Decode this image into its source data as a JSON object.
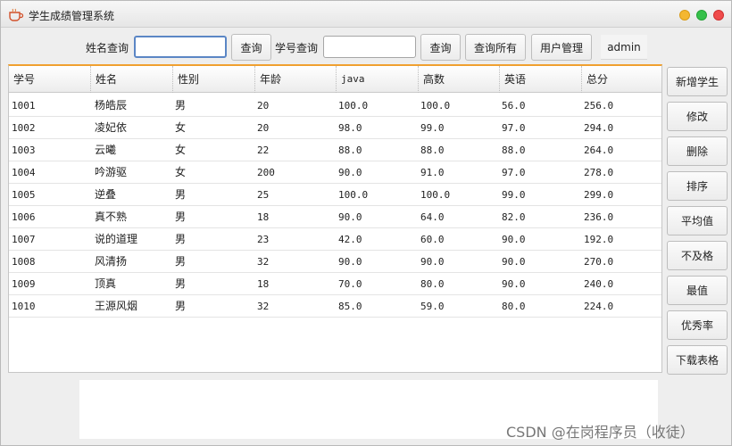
{
  "window": {
    "title": "学生成绩管理系统"
  },
  "search": {
    "name_label": "姓名查询",
    "name_value": "",
    "name_button": "查询",
    "id_label": "学号查询",
    "id_value": "",
    "id_button": "查询",
    "all_button": "查询所有",
    "user_button": "用户管理",
    "user_name": "admin"
  },
  "table": {
    "columns": [
      "学号",
      "姓名",
      "性别",
      "年龄",
      "java",
      "高数",
      "英语",
      "总分"
    ],
    "rows": [
      [
        "1001",
        "杨皓辰",
        "男",
        "20",
        "100.0",
        "100.0",
        "56.0",
        "256.0"
      ],
      [
        "1002",
        "凌妃依",
        "女",
        "20",
        "98.0",
        "99.0",
        "97.0",
        "294.0"
      ],
      [
        "1003",
        "云曦",
        "女",
        "22",
        "88.0",
        "88.0",
        "88.0",
        "264.0"
      ],
      [
        "1004",
        "吟游驱",
        "女",
        "200",
        "90.0",
        "91.0",
        "97.0",
        "278.0"
      ],
      [
        "1005",
        "逆叠",
        "男",
        "25",
        "100.0",
        "100.0",
        "99.0",
        "299.0"
      ],
      [
        "1006",
        "真不熟",
        "男",
        "18",
        "90.0",
        "64.0",
        "82.0",
        "236.0"
      ],
      [
        "1007",
        "说的道理",
        "男",
        "23",
        "42.0",
        "60.0",
        "90.0",
        "192.0"
      ],
      [
        "1008",
        "风清扬",
        "男",
        "32",
        "90.0",
        "90.0",
        "90.0",
        "270.0"
      ],
      [
        "1009",
        "顶真",
        "男",
        "18",
        "70.0",
        "80.0",
        "90.0",
        "240.0"
      ],
      [
        "1010",
        "王源风烟",
        "男",
        "32",
        "85.0",
        "59.0",
        "80.0",
        "224.0"
      ]
    ]
  },
  "actions": [
    "新增学生",
    "修改",
    "删除",
    "排序",
    "平均值",
    "不及格",
    "最值",
    "优秀率",
    "下载表格"
  ],
  "watermark": "CSDN @在岗程序员（收徒）",
  "icons": {
    "app": "coffee-cup-icon"
  },
  "colors": {
    "accent": "#f0a030",
    "focus": "#5b86c5",
    "minimize": "#f4b731",
    "maximize": "#36c04a",
    "close": "#ef4b4b"
  }
}
